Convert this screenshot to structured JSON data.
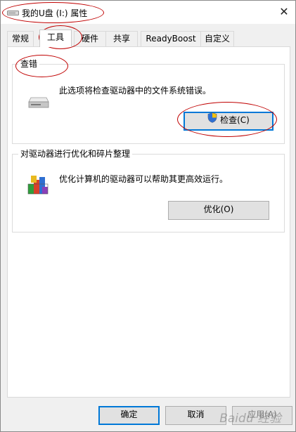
{
  "window": {
    "title": "我的U盘 (I:) 属性",
    "close_glyph": "✕"
  },
  "tabs": [
    {
      "label": "常规",
      "active": false
    },
    {
      "label": "工具",
      "active": true
    },
    {
      "label": "硬件",
      "active": false
    },
    {
      "label": "共享",
      "active": false
    },
    {
      "label": "ReadyBoost",
      "active": false
    },
    {
      "label": "自定义",
      "active": false
    }
  ],
  "error_check": {
    "title": "查错",
    "description": "此选项将检查驱动器中的文件系统错误。",
    "button_label": "检查(C)",
    "icon": "drive-icon"
  },
  "optimize": {
    "title": "对驱动器进行优化和碎片整理",
    "description": "优化计算机的驱动器可以帮助其更高效运行。",
    "button_label": "优化(O)",
    "icon": "defrag-icon"
  },
  "footer": {
    "ok_label": "确定",
    "cancel_label": "取消",
    "apply_label": "应用(A)"
  },
  "watermark": "Baidu 经验",
  "colors": {
    "annotation": "#c00000",
    "accent": "#0078d7"
  }
}
